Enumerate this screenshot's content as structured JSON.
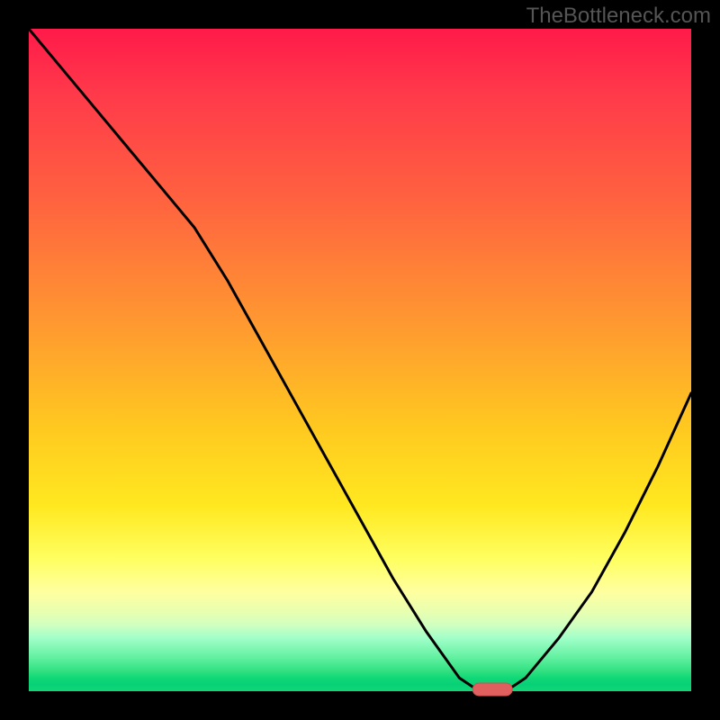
{
  "watermark": "TheBottleneck.com",
  "chart_data": {
    "type": "line",
    "title": "",
    "xlabel": "",
    "ylabel": "",
    "x": [
      0.0,
      0.05,
      0.1,
      0.15,
      0.2,
      0.25,
      0.3,
      0.35,
      0.4,
      0.45,
      0.5,
      0.55,
      0.6,
      0.65,
      0.68,
      0.7,
      0.72,
      0.75,
      0.8,
      0.85,
      0.9,
      0.95,
      1.0
    ],
    "values": [
      1.0,
      0.94,
      0.88,
      0.82,
      0.76,
      0.7,
      0.62,
      0.53,
      0.44,
      0.35,
      0.26,
      0.17,
      0.09,
      0.02,
      0.0,
      0.0,
      0.0,
      0.02,
      0.08,
      0.15,
      0.24,
      0.34,
      0.45
    ],
    "xlim": [
      0,
      1
    ],
    "ylim": [
      0,
      1
    ],
    "marker": {
      "x": 0.7,
      "y": 0.0
    }
  },
  "colors": {
    "gradient_top": "#ff1a4a",
    "gradient_bottom": "#10d878",
    "marker": "#e06060"
  }
}
